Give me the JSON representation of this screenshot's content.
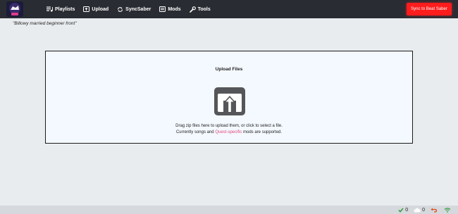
{
  "header": {
    "nav": [
      {
        "label": "Playlists",
        "icon": "playlist-icon"
      },
      {
        "label": "Upload",
        "icon": "upload-icon"
      },
      {
        "label": "SyncSaber",
        "icon": "sync-icon"
      },
      {
        "label": "Mods",
        "icon": "mods-icon"
      },
      {
        "label": "Tools",
        "icon": "wrench-icon"
      }
    ],
    "sync_button": "Sync to Beat Saber"
  },
  "page": {
    "subtitle": "\"Billowy married beginner front\""
  },
  "dropzone": {
    "title": "Upload Files",
    "line1": "Drag zip files here to upload them, or click to select a file.",
    "line2_prefix": "Currently songs and ",
    "line2_link": "Quest-specific",
    "line2_suffix": " mods are supported."
  },
  "statusbar": {
    "done_count": "0",
    "cloud_count": "0"
  },
  "colors": {
    "accent_red": "#ff1c1c",
    "link_pink": "#e0457b",
    "topbar": "#2a2c33",
    "dropzone_bg": "#f4f9ff"
  }
}
